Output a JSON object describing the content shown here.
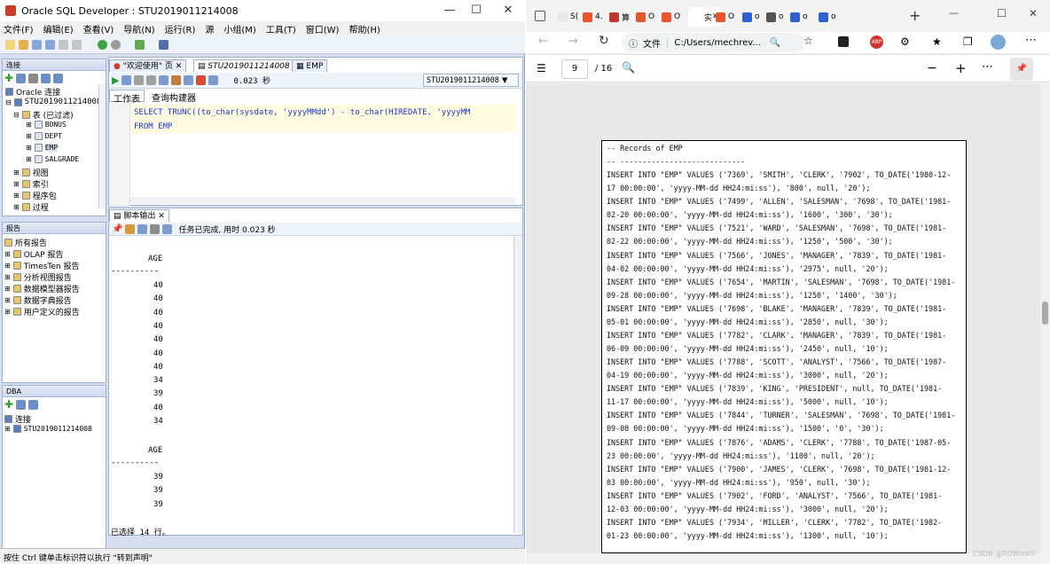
{
  "sqldev": {
    "title": "Oracle SQL Developer : STU2019011214008",
    "menus": [
      "文件(F)",
      "编辑(E)",
      "查看(V)",
      "导航(N)",
      "运行(R)",
      "源",
      "小组(M)",
      "工具(T)",
      "窗口(W)",
      "帮助(H)"
    ],
    "connections_label": "连接",
    "tree": {
      "root": "Oracle 连接",
      "conn": "STU2019011214008",
      "tables": "表 (已过滤)",
      "tables_list": [
        "BONUS",
        "DEPT",
        "EMP",
        "SALGRADE"
      ],
      "views": "视图",
      "indexes": "索引",
      "packages": "程序包",
      "procedures": "过程"
    },
    "reports_label": "报告",
    "reports": [
      "所有报告",
      "OLAP 报告",
      "TimesTen 报告",
      "分析视图报告",
      "数据模型器报告",
      "数据字典报告",
      "用户定义的报告"
    ],
    "dba_label": "DBA",
    "dba_conn_header": "连接",
    "dba_conn": "STU2019011214008",
    "tabs": [
      "\"欢迎使用\" 页",
      "STU2019011214008",
      "EMP"
    ],
    "conn_select": "STU2019011214008",
    "exec_time": "0.023 秒",
    "subtabs": [
      "工作表",
      "查询构建器"
    ],
    "sql_line1": "SELECT TRUNC((to_char(sysdate, 'yyyyMMdd') - to_char(HIREDATE, 'yyyyMM",
    "sql_line2": "FROM EMP",
    "output_tab": "脚本输出",
    "output_status": "任务已完成, 用时 0.023 秒",
    "col_header": "AGE",
    "separator": "----------",
    "values_1": [
      "40",
      "40",
      "40",
      "40",
      "40",
      "40",
      "40",
      "34",
      "39",
      "40",
      "34"
    ],
    "values_2": [
      "39",
      "39",
      "39"
    ],
    "rows_selected": "已选择 14 行。",
    "statusbar": "按住 Ctrl 键单击标识符以执行 \"转到声明\""
  },
  "browser": {
    "tabs": [
      "S(",
      "4.",
      "算",
      "O",
      "O",
      "实",
      "O",
      "o",
      "o",
      "o",
      "o"
    ],
    "address_label": "文件",
    "address": "C:/Users/mechrev...",
    "page_current": "9",
    "page_total": "/ 16",
    "pdf_lines": [
      "-- Records of EMP",
      "-- ----------------------------",
      "INSERT INTO \"EMP\" VALUES ('7369', 'SMITH', 'CLERK', '7902', TO_DATE('1980-12-",
      "17 00:00:00', 'yyyy-MM-dd HH24:mi:ss'), '800', null, '20');",
      "INSERT INTO \"EMP\" VALUES ('7499', 'ALLEN', 'SALESMAN', '7698', TO_DATE('1981-",
      "02-20 00:00:00', 'yyyy-MM-dd HH24:mi:ss'), '1600', '300', '30');",
      "INSERT INTO \"EMP\" VALUES ('7521', 'WARD', 'SALESMAN', '7698', TO_DATE('1981-",
      "02-22 00:00:00', 'yyyy-MM-dd HH24:mi:ss'), '1250', '500', '30');",
      "INSERT INTO \"EMP\" VALUES ('7566', 'JONES', 'MANAGER', '7839', TO_DATE('1981-",
      "04-02 00:00:00', 'yyyy-MM-dd HH24:mi:ss'), '2975', null, '20');",
      "INSERT INTO \"EMP\" VALUES ('7654', 'MARTIN', 'SALESMAN', '7698', TO_DATE('1981-",
      "09-28 00:00:00', 'yyyy-MM-dd HH24:mi:ss'), '1250', '1400', '30');",
      "INSERT INTO \"EMP\" VALUES ('7698', 'BLAKE', 'MANAGER', '7839', TO_DATE('1981-",
      "05-01 00:00:00', 'yyyy-MM-dd HH24:mi:ss'), '2850', null, '30');",
      "INSERT INTO \"EMP\" VALUES ('7782', 'CLARK', 'MANAGER', '7839', TO_DATE('1981-",
      "06-09 00:00:00', 'yyyy-MM-dd HH24:mi:ss'), '2450', null, '10');",
      "INSERT INTO \"EMP\" VALUES ('7788', 'SCOTT', 'ANALYST', '7566', TO_DATE('1987-",
      "04-19 00:00:00', 'yyyy-MM-dd HH24:mi:ss'), '3000', null, '20');",
      "INSERT INTO \"EMP\" VALUES ('7839', 'KING', 'PRESIDENT', null, TO_DATE('1981-",
      "11-17 00:00:00', 'yyyy-MM-dd HH24:mi:ss'), '5000', null, '10');",
      "INSERT INTO \"EMP\" VALUES ('7844', 'TURNER', 'SALESMAN', '7698', TO_DATE('1981-",
      "09-08 00:00:00', 'yyyy-MM-dd HH24:mi:ss'), '1500', '0', '30');",
      "INSERT INTO \"EMP\" VALUES ('7876', 'ADAMS', 'CLERK', '7788', TO_DATE('1987-05-",
      "23 00:00:00', 'yyyy-MM-dd HH24:mi:ss'), '1100', null, '20');",
      "INSERT INTO \"EMP\" VALUES ('7900', 'JAMES', 'CLERK', '7698', TO_DATE('1981-12-",
      "03 00:00:00', 'yyyy-MM-dd HH24:mi:ss'), '950', null, '30');",
      "INSERT INTO \"EMP\" VALUES ('7902', 'FORD', 'ANALYST', '7566', TO_DATE('1981-",
      "12-03 00:00:00', 'yyyy-MM-dd HH24:mi:ss'), '3000', null, '20');",
      "INSERT INTO \"EMP\" VALUES ('7934', 'MILLER', 'CLERK', '7782', TO_DATE('1982-",
      "01-23 00:00:00', 'yyyy-MM-dd HH24:mi:ss'), '1300', null, '10');"
    ],
    "watermark": "CSDN @ROBlink0"
  }
}
